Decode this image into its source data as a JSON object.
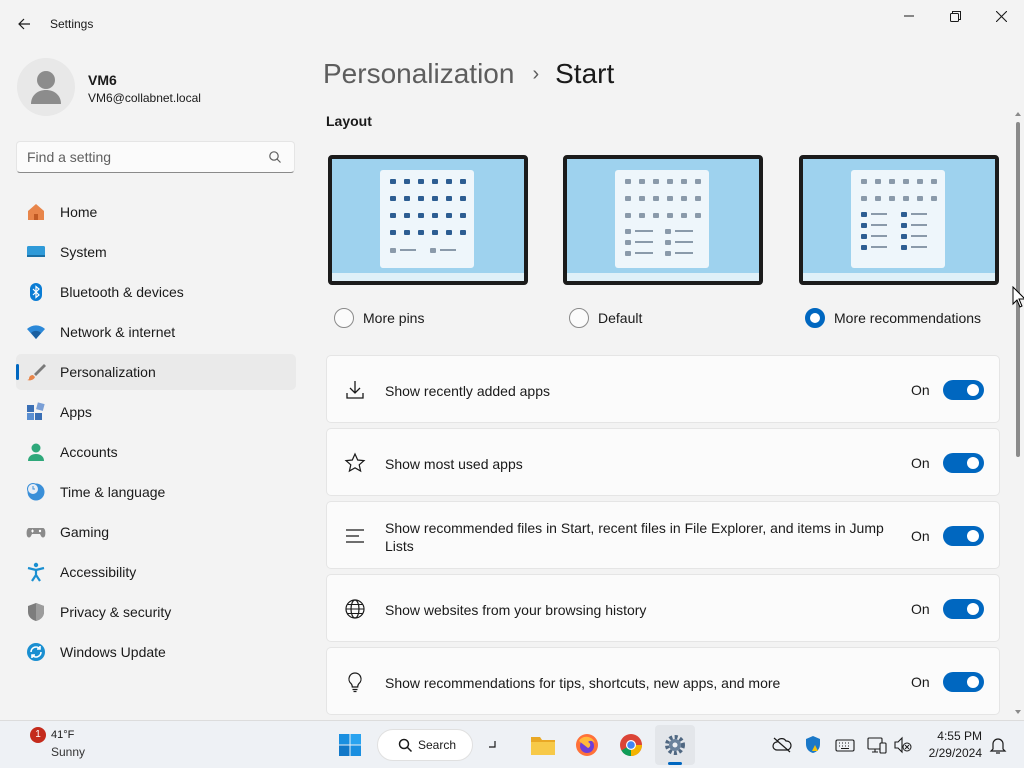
{
  "window": {
    "title": "Settings"
  },
  "user": {
    "name": "VM6",
    "email": "VM6@collabnet.local"
  },
  "search": {
    "placeholder": "Find a setting"
  },
  "sidebar": {
    "items": [
      {
        "label": "Home",
        "icon": "home-icon",
        "active": false
      },
      {
        "label": "System",
        "icon": "system-icon",
        "active": false
      },
      {
        "label": "Bluetooth & devices",
        "icon": "bluetooth-icon",
        "active": false
      },
      {
        "label": "Network & internet",
        "icon": "wifi-icon",
        "active": false
      },
      {
        "label": "Personalization",
        "icon": "brush-icon",
        "active": true
      },
      {
        "label": "Apps",
        "icon": "apps-icon",
        "active": false
      },
      {
        "label": "Accounts",
        "icon": "accounts-icon",
        "active": false
      },
      {
        "label": "Time & language",
        "icon": "clock-globe-icon",
        "active": false
      },
      {
        "label": "Gaming",
        "icon": "gamepad-icon",
        "active": false
      },
      {
        "label": "Accessibility",
        "icon": "accessibility-icon",
        "active": false
      },
      {
        "label": "Privacy & security",
        "icon": "shield-icon",
        "active": false
      },
      {
        "label": "Windows Update",
        "icon": "update-icon",
        "active": false
      }
    ]
  },
  "main": {
    "breadcrumb_parent": "Personalization",
    "breadcrumb_separator": "›",
    "breadcrumb_current": "Start",
    "layout_section_title": "Layout",
    "layout_options": [
      {
        "label": "More pins",
        "selected": false
      },
      {
        "label": "Default",
        "selected": false
      },
      {
        "label": "More recommendations",
        "selected": true
      }
    ],
    "settings": [
      {
        "label": "Show recently added apps",
        "state": "On",
        "icon": "download-icon",
        "on": true
      },
      {
        "label": "Show most used apps",
        "state": "On",
        "icon": "star-icon",
        "on": true
      },
      {
        "label": "Show recommended files in Start, recent files in File Explorer, and items in Jump Lists",
        "state": "On",
        "icon": "list-icon",
        "on": true
      },
      {
        "label": "Show websites from your browsing history",
        "state": "On",
        "icon": "globe-icon",
        "on": true
      },
      {
        "label": "Show recommendations for tips, shortcuts, new apps, and more",
        "state": "On",
        "icon": "lightbulb-icon",
        "on": true
      }
    ]
  },
  "taskbar": {
    "weather_badge": "1",
    "weather_temp": "41°F",
    "weather_condition": "Sunny",
    "search_label": "Search",
    "time": "4:55 PM",
    "date": "2/29/2024"
  },
  "colors": {
    "accent": "#0067c0",
    "background": "#f3f3f3",
    "card": "#fbfbfb"
  }
}
